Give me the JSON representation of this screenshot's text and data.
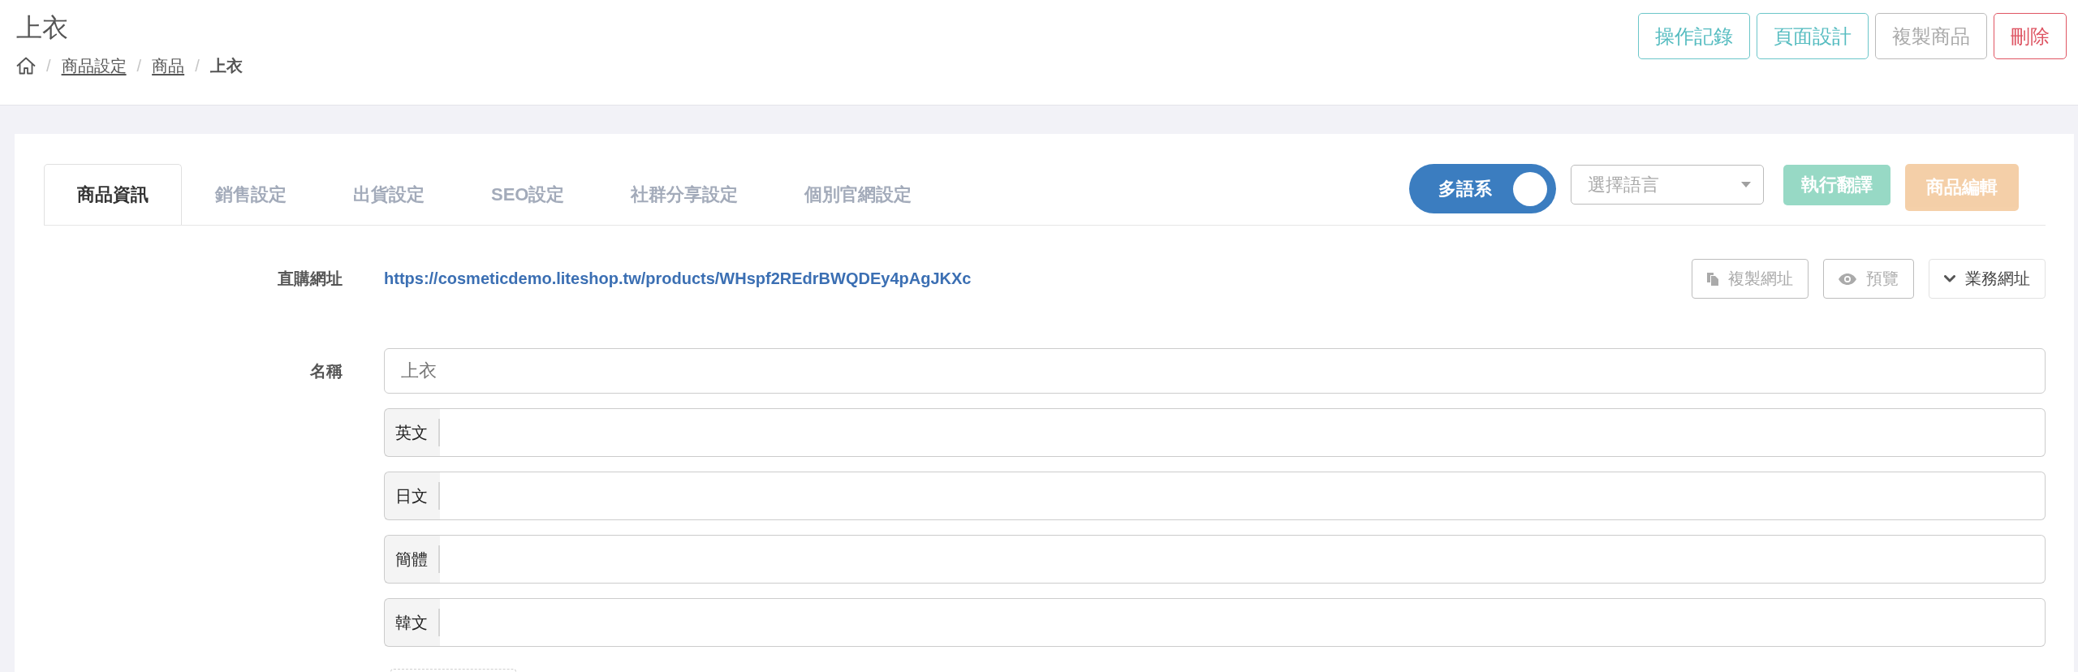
{
  "header": {
    "title": "上衣",
    "separator": "/",
    "breadcrumb": [
      {
        "kind": "home"
      },
      {
        "kind": "link",
        "label": "商品設定"
      },
      {
        "kind": "link",
        "label": "商品"
      },
      {
        "kind": "current",
        "label": "上衣"
      }
    ],
    "actions": [
      {
        "label": "操作記錄",
        "kind": "info"
      },
      {
        "label": "頁面設計",
        "kind": "info"
      },
      {
        "label": "複製商品",
        "kind": "muted"
      },
      {
        "label": "刪除",
        "kind": "danger"
      }
    ]
  },
  "tabs": [
    {
      "label": "商品資訊",
      "selected": true
    },
    {
      "label": "銷售設定",
      "selected": false
    },
    {
      "label": "出貨設定",
      "selected": false
    },
    {
      "label": "SEO設定",
      "selected": false
    },
    {
      "label": "社群分享設定",
      "selected": false
    },
    {
      "label": "個別官網設定",
      "selected": false
    }
  ],
  "language_toggle": {
    "label": "多語系",
    "on": true
  },
  "language_select": {
    "placeholder": "選擇語言"
  },
  "tab_actions": [
    {
      "label": "執行翻譯",
      "kind": "success",
      "disabled": true
    },
    {
      "label": "商品編輯",
      "kind": "warning",
      "disabled": true
    }
  ],
  "url_row": {
    "label": "直購網址",
    "url": "https://cosmeticdemo.liteshop.tw/products/WHspf2REdrBWQDEy4pAgJKXc",
    "actions": [
      {
        "label": "複製網址",
        "kind": "copy",
        "disabled": true
      },
      {
        "label": "預覽",
        "kind": "preview",
        "disabled": true
      },
      {
        "label": "業務網址",
        "kind": "dropdown",
        "disabled": false
      }
    ]
  },
  "name_row": {
    "label": "名稱",
    "value": "上衣",
    "translations": [
      {
        "language": "英文"
      },
      {
        "language": "日文"
      },
      {
        "language": "簡體"
      },
      {
        "language": "韓文"
      }
    ]
  }
}
